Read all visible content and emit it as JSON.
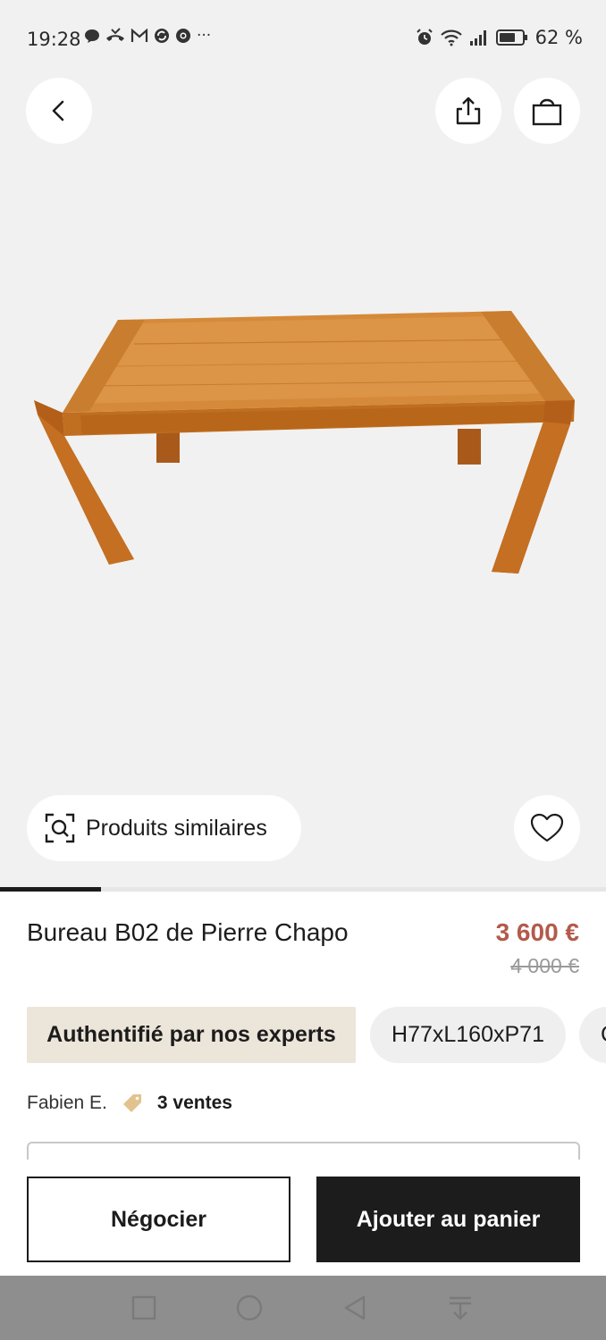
{
  "status_bar": {
    "time": "19:28",
    "notification_icons": [
      "chat-icon",
      "missed-call-icon",
      "gmail-icon",
      "sync-icon",
      "chrome-icon"
    ],
    "more": "···",
    "battery": "62 %"
  },
  "hero": {
    "similar_label": "Produits similaires"
  },
  "product": {
    "title": "Bureau B02 de Pierre Chapo",
    "price": "3 600 €",
    "old_price": "4 000 €",
    "chips": [
      "Authentifié par nos experts",
      "H77xL160xP71",
      "C"
    ],
    "seller": "Fabien E.",
    "sales": "3 ventes"
  },
  "actions": {
    "negotiate": "Négocier",
    "add_to_cart": "Ajouter au panier"
  },
  "image_carousel": {
    "position_fraction": 0.167
  },
  "colors": {
    "price": "#b35a4b",
    "chip_auth_bg": "#ece5da",
    "primary_button": "#1c1c1c",
    "background": "#f2f1f1"
  }
}
